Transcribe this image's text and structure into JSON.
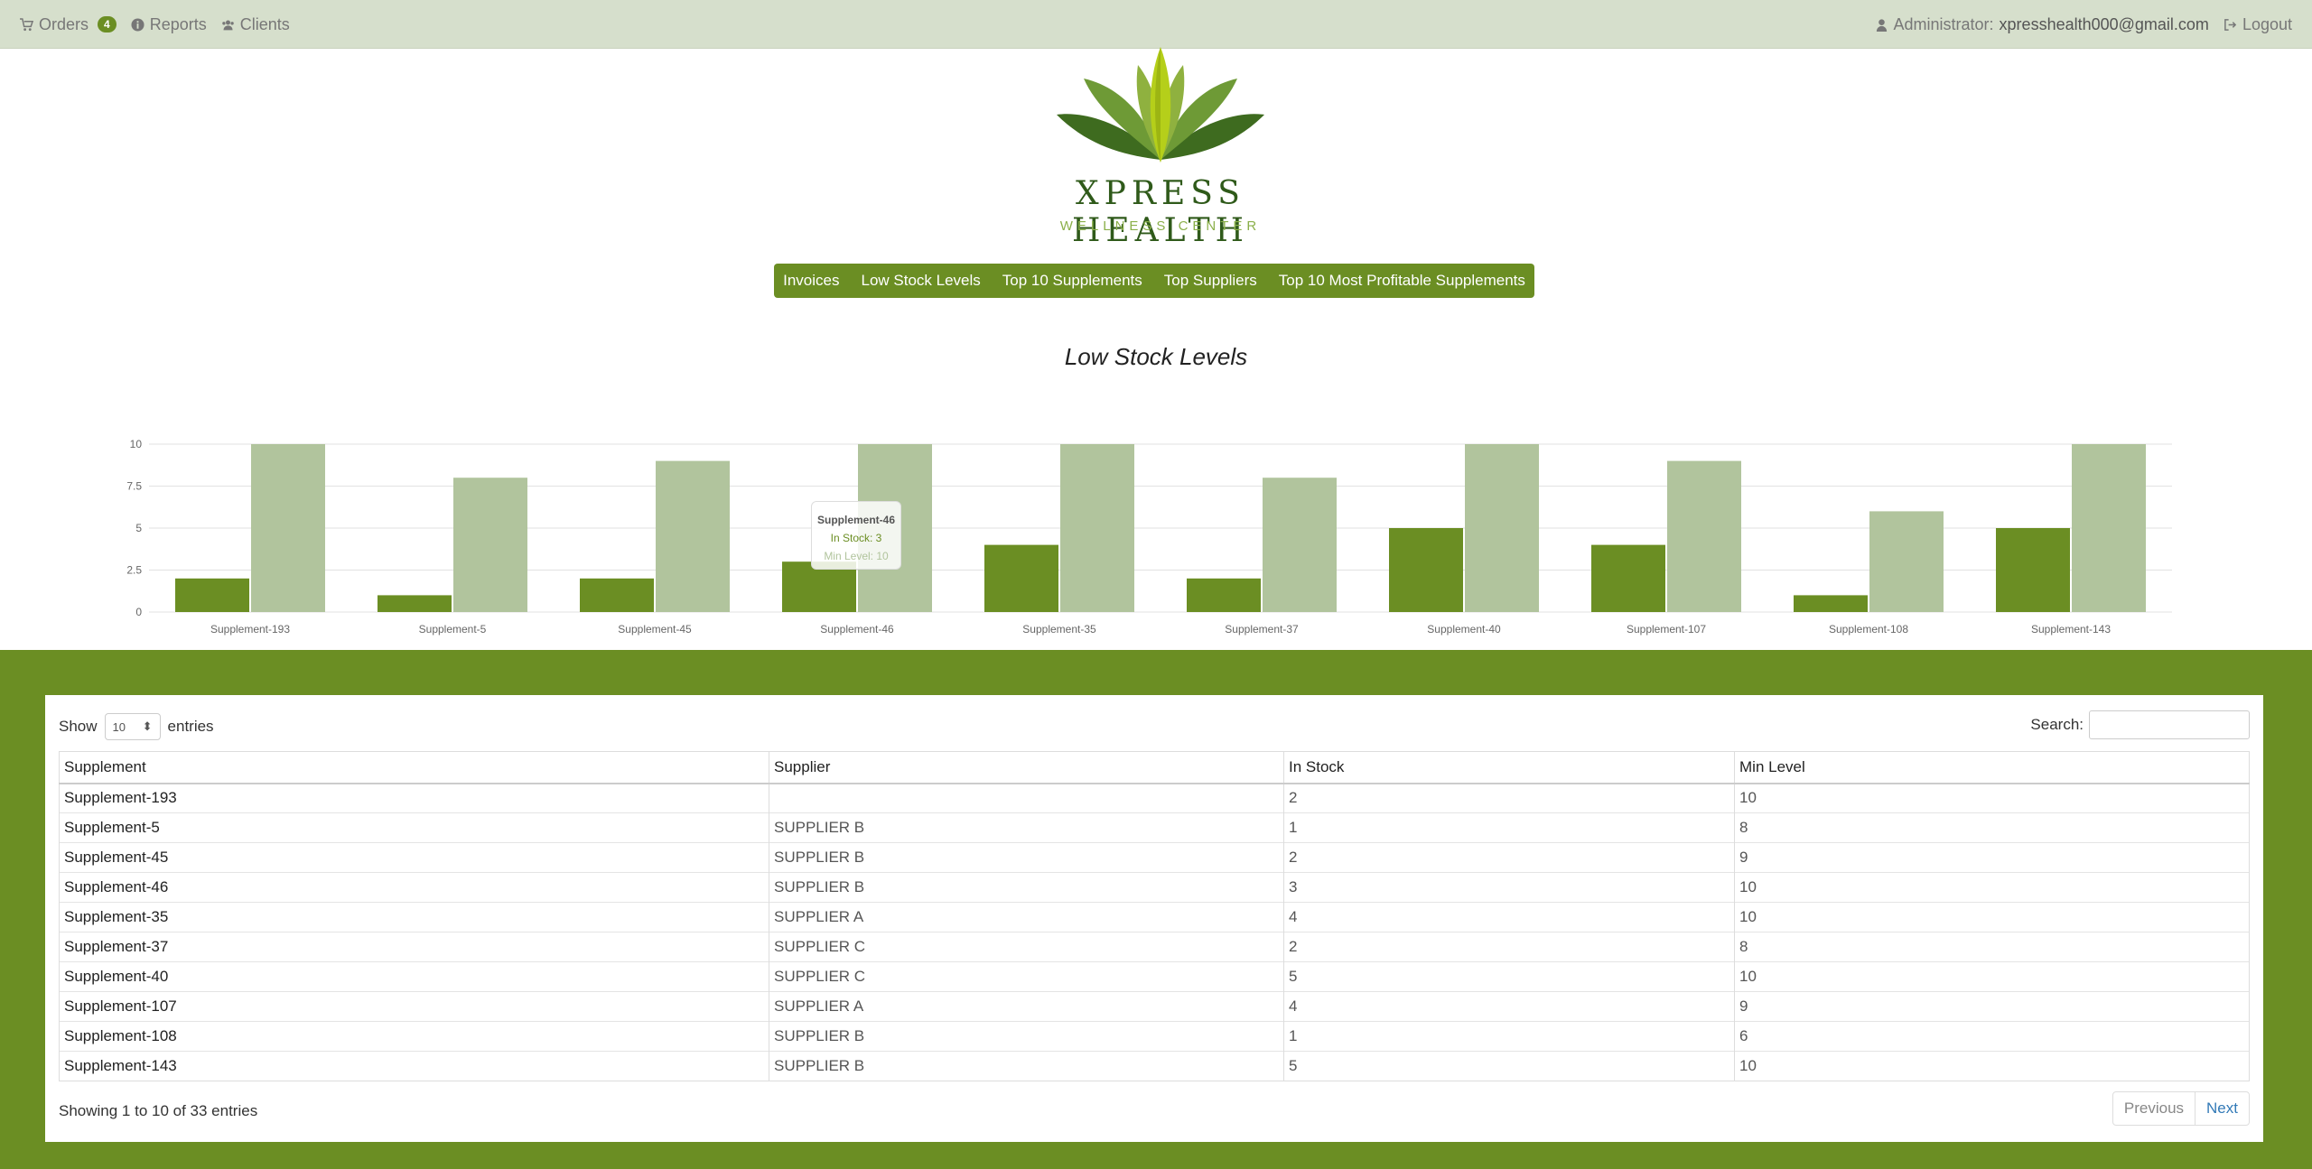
{
  "topbar": {
    "orders_label": "Orders",
    "orders_count": "4",
    "reports_label": "Reports",
    "clients_label": "Clients",
    "admin_label": "Administrator:",
    "admin_email": "xpresshealth000@gmail.com",
    "logout_label": "Logout"
  },
  "logo": {
    "title": "XPRESS HEALTH",
    "subtitle": "WELLNESS CENTER"
  },
  "menu": [
    "Invoices",
    "Low Stock Levels",
    "Top 10 Supplements",
    "Top Suppliers",
    "Top 10 Most Profitable Supplements"
  ],
  "chart_title": "Low Stock Levels",
  "colors": {
    "accent": "#6b8e23",
    "light": "#b1c49d",
    "topbar": "#d6dfcc"
  },
  "chart_data": {
    "type": "bar",
    "title": "Low Stock Levels",
    "categories": [
      "Supplement-193",
      "Supplement-5",
      "Supplement-45",
      "Supplement-46",
      "Supplement-35",
      "Supplement-37",
      "Supplement-40",
      "Supplement-107",
      "Supplement-108",
      "Supplement-143"
    ],
    "series": [
      {
        "name": "In Stock",
        "values": [
          2,
          1,
          2,
          3,
          4,
          2,
          5,
          4,
          1,
          5
        ]
      },
      {
        "name": "Min Level",
        "values": [
          10,
          8,
          9,
          10,
          10,
          8,
          10,
          9,
          6,
          10
        ]
      }
    ],
    "yticks": [
      "0",
      "2.5",
      "5",
      "7.5",
      "10"
    ],
    "ylim": [
      0,
      10
    ],
    "grid": true
  },
  "tooltip": {
    "title": "Supplement-46",
    "line1": "In Stock: 3",
    "line2": "Min Level: 10"
  },
  "table": {
    "show_label": "Show",
    "entries_value": "10",
    "entries_label": "entries",
    "search_label": "Search:",
    "headers": [
      "Supplement",
      "Supplier",
      "In Stock",
      "Min Level"
    ],
    "rows": [
      [
        "Supplement-193",
        "",
        "2",
        "10"
      ],
      [
        "Supplement-5",
        "SUPPLIER B",
        "1",
        "8"
      ],
      [
        "Supplement-45",
        "SUPPLIER B",
        "2",
        "9"
      ],
      [
        "Supplement-46",
        "SUPPLIER B",
        "3",
        "10"
      ],
      [
        "Supplement-35",
        "SUPPLIER A",
        "4",
        "10"
      ],
      [
        "Supplement-37",
        "SUPPLIER C",
        "2",
        "8"
      ],
      [
        "Supplement-40",
        "SUPPLIER C",
        "5",
        "10"
      ],
      [
        "Supplement-107",
        "SUPPLIER A",
        "4",
        "9"
      ],
      [
        "Supplement-108",
        "SUPPLIER B",
        "1",
        "6"
      ],
      [
        "Supplement-143",
        "SUPPLIER B",
        "5",
        "10"
      ]
    ],
    "info": "Showing 1 to 10 of 33 entries",
    "prev_label": "Previous",
    "next_label": "Next"
  }
}
